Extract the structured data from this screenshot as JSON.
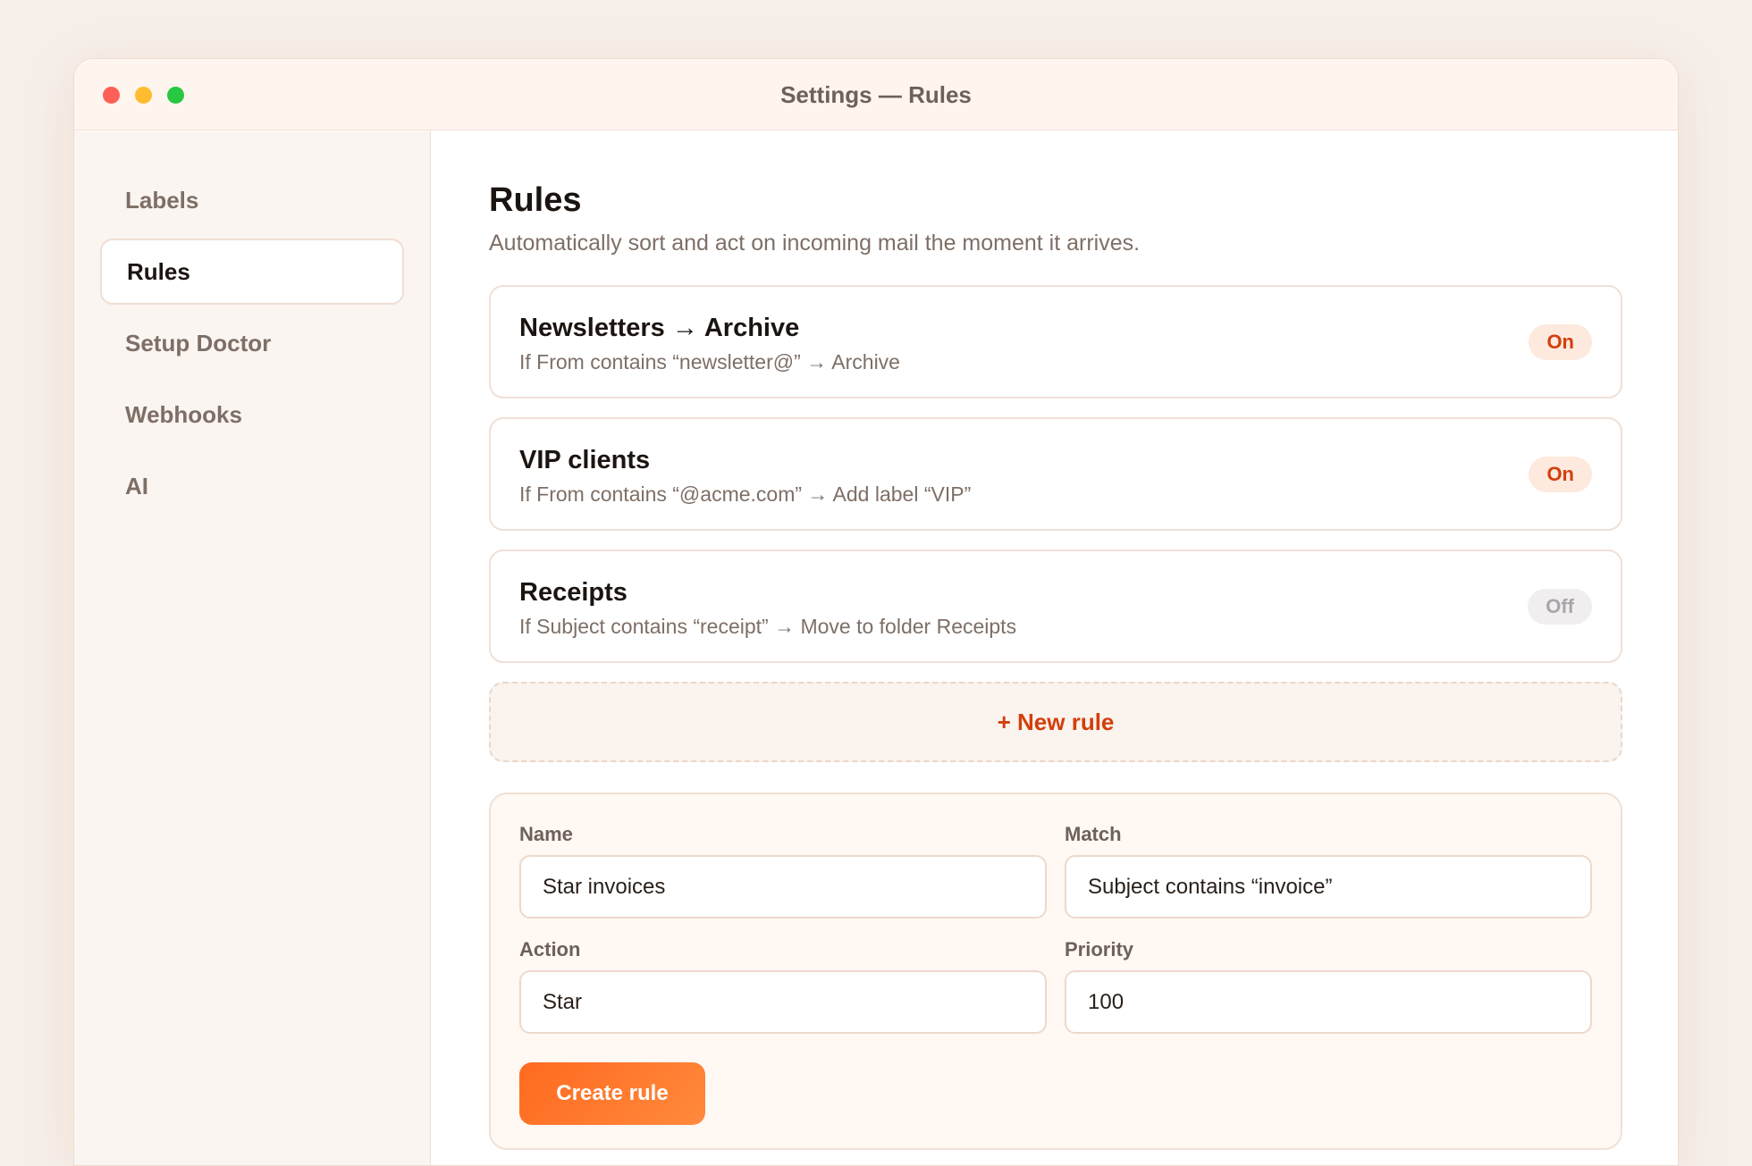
{
  "window": {
    "title": "Settings — Rules"
  },
  "sidebar": {
    "items": [
      {
        "label": "Labels",
        "active": false
      },
      {
        "label": "Rules",
        "active": true
      },
      {
        "label": "Setup Doctor",
        "active": false
      },
      {
        "label": "Webhooks",
        "active": false
      },
      {
        "label": "AI",
        "active": false
      }
    ]
  },
  "main": {
    "title": "Rules",
    "subtitle": "Automatically sort and act on incoming mail the moment it arrives.",
    "rules": [
      {
        "title": "Newsletters → Archive",
        "description": "If From contains “newsletter@” → Archive",
        "status": "On"
      },
      {
        "title": "VIP clients",
        "description": "If From contains “@acme.com” → Add label “VIP”",
        "status": "On"
      },
      {
        "title": "Receipts",
        "description": "If Subject contains “receipt” → Move to folder Receipts",
        "status": "Off"
      }
    ],
    "new_rule_label": "+ New rule",
    "form": {
      "name_label": "Name",
      "name_value": "Star invoices",
      "match_label": "Match",
      "match_value": "Subject contains “invoice”",
      "action_label": "Action",
      "action_value": "Star",
      "priority_label": "Priority",
      "priority_value": "100",
      "submit_label": "Create rule"
    }
  },
  "colors": {
    "accent": "#d23f0c",
    "button_gradient_start": "#ff6a1f",
    "button_gradient_end": "#ff8a3d"
  }
}
